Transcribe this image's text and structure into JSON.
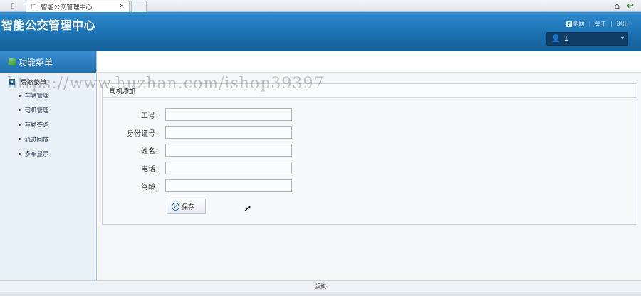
{
  "browser": {
    "tab_title": "智能公交管理中心",
    "tab_close": "×"
  },
  "header": {
    "app_title": "智能公交管理中心",
    "links": {
      "help": "帮助",
      "about": "关于",
      "logout": "退出"
    },
    "user": {
      "name": "1"
    }
  },
  "sidebar": {
    "title": "功能菜单",
    "group_label": "导航菜单",
    "items": [
      {
        "label": "车辆管理"
      },
      {
        "label": "司机管理"
      },
      {
        "label": "车辆查询"
      },
      {
        "label": "轨迹回放"
      },
      {
        "label": "多车显示"
      }
    ]
  },
  "form": {
    "title": "司机添加",
    "fields": [
      {
        "label": "工号：",
        "value": ""
      },
      {
        "label": "身份证号：",
        "value": ""
      },
      {
        "label": "姓名：",
        "value": ""
      },
      {
        "label": "电话：",
        "value": ""
      },
      {
        "label": "驾龄：",
        "value": ""
      }
    ],
    "save_label": "保存"
  },
  "footer": {
    "text": "版权"
  },
  "watermark": {
    "text": "https://www.huzhan.com/ishop39397"
  },
  "icons": {
    "help": "question-icon",
    "user": "user-icon",
    "menu": "cube-icon",
    "save": "check-circle-icon"
  }
}
